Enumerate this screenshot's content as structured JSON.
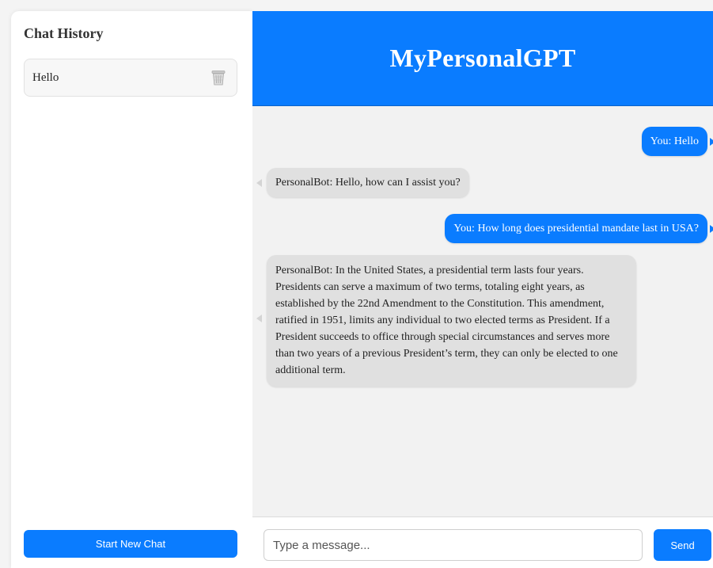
{
  "sidebar": {
    "title": "Chat History",
    "history": [
      {
        "label": "Hello",
        "delete_icon": "trash-icon"
      }
    ],
    "new_chat_label": "Start New Chat"
  },
  "header": {
    "title": "MyPersonalGPT"
  },
  "messages": [
    {
      "role": "user",
      "text": "You: Hello"
    },
    {
      "role": "bot",
      "text": "PersonalBot: Hello, how can I assist you?"
    },
    {
      "role": "user",
      "text": "You: How long does presidential mandate last in USA?"
    },
    {
      "role": "bot",
      "text": "PersonalBot: In the United States, a presidential term lasts four years. Presidents can serve a maximum of two terms, totaling eight years, as established by the 22nd Amendment to the Constitution. This amendment, ratified in 1951, limits any individual to two elected terms as President. If a President succeeds to office through special circumstances and serves more than two years of a previous President’s term, they can only be elected to one additional term."
    }
  ],
  "composer": {
    "placeholder": "Type a message...",
    "value": "",
    "send_label": "Send"
  },
  "colors": {
    "accent": "#0a7cff",
    "bot_bubble": "#e0e0e0",
    "background": "#f2f2f2"
  }
}
